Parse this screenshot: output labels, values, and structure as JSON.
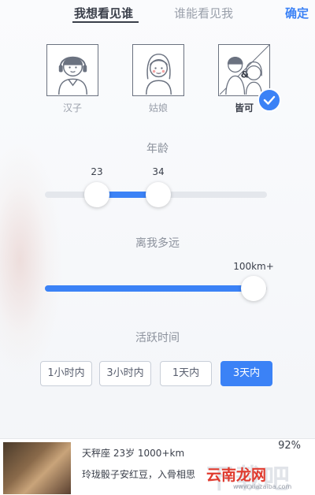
{
  "header": {
    "tab_active": "我想看见谁",
    "tab_inactive": "谁能看见我",
    "confirm_label": "确定"
  },
  "gender_options": [
    {
      "label": "汉子",
      "icon": "man-avatar-icon",
      "selected": false
    },
    {
      "label": "姑娘",
      "icon": "woman-avatar-icon",
      "selected": false
    },
    {
      "label": "皆可",
      "icon": "couple-avatar-icon",
      "selected": true
    }
  ],
  "age": {
    "title": "年龄",
    "min": 23,
    "max": 34,
    "min_label": "23",
    "max_label": "34"
  },
  "distance": {
    "title": "离我多远",
    "value_label": "100km+",
    "level": 1.0
  },
  "activity": {
    "title": "活跃时间",
    "options": [
      "1小时内",
      "3小时内",
      "1天内",
      "3天内"
    ],
    "selected": "3天内"
  },
  "card": {
    "line1": "天秤座 23岁 1000+km",
    "line2": "玲珑骰子安红豆，入骨相思",
    "percent": "92%"
  },
  "watermark": {
    "big": "下载吧",
    "brand": "云南龙网",
    "url": "www.xiazaiba.com"
  },
  "colors": {
    "accent": "#3b82f6",
    "text_dark": "#3a3f4a",
    "text_muted": "#9aa0ab",
    "track": "#e4e7ec",
    "brand_red": "#e03a2e"
  }
}
